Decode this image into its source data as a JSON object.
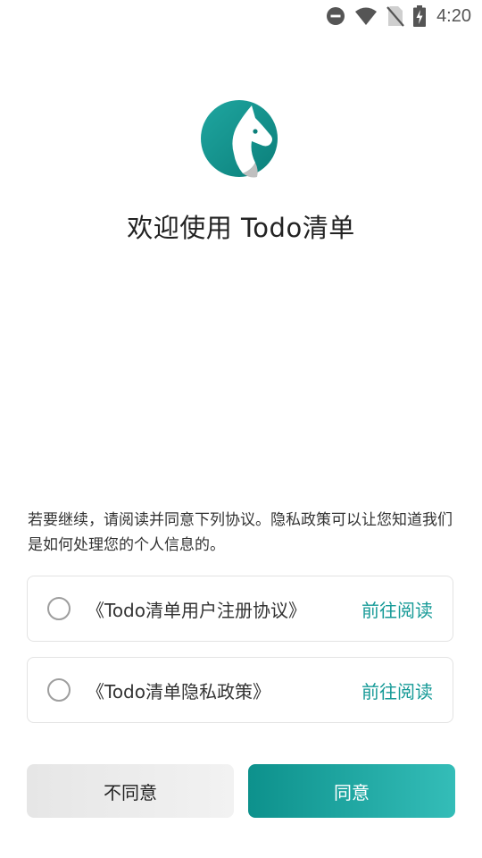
{
  "status_bar": {
    "time": "4:20",
    "icons": [
      "do-not-disturb-icon",
      "wifi-icon",
      "no-sim-icon",
      "battery-charging-icon"
    ]
  },
  "welcome": {
    "logo_icon": "horse-head-logo-icon",
    "title": "欢迎使用 Todo清单"
  },
  "notice": {
    "text": "若要继续，请阅读并同意下列协议。隐私政策可以让您知道我们是如何处理您的个人信息的。"
  },
  "agreements": [
    {
      "label": "《Todo清单用户注册协议》",
      "link": "前往阅读",
      "checked": false
    },
    {
      "label": "《Todo清单隐私政策》",
      "link": "前往阅读",
      "checked": false
    }
  ],
  "buttons": {
    "disagree": "不同意",
    "agree": "同意"
  },
  "colors": {
    "accent": "#169a97",
    "agree_gradient_start": "#0d918c",
    "agree_gradient_end": "#34bdb8",
    "disagree_bg": "#ececec"
  }
}
